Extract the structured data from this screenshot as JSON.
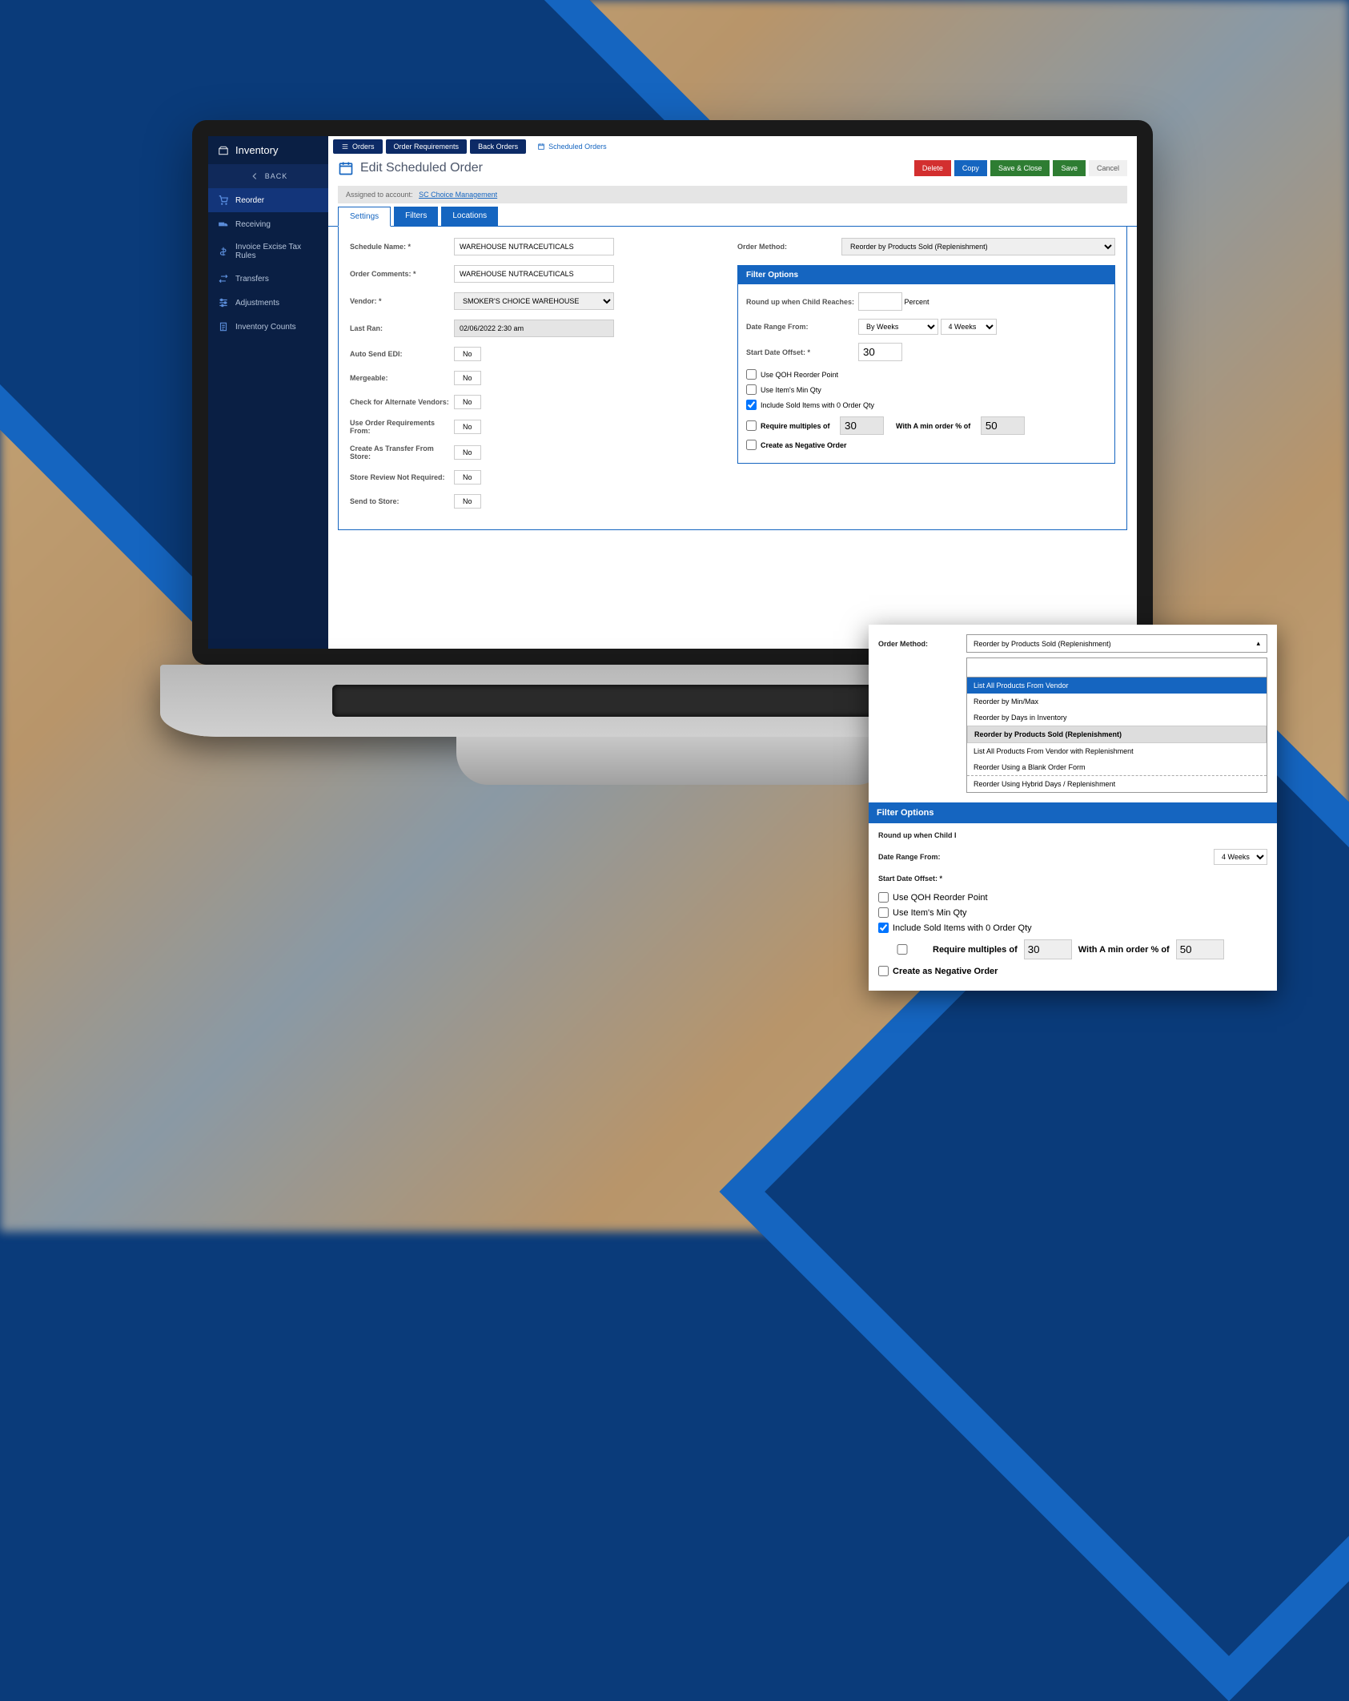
{
  "sidebar": {
    "title": "Inventory",
    "back": "BACK",
    "items": [
      {
        "label": "Reorder"
      },
      {
        "label": "Receiving"
      },
      {
        "label": "Invoice Excise Tax Rules"
      },
      {
        "label": "Transfers"
      },
      {
        "label": "Adjustments"
      },
      {
        "label": "Inventory Counts"
      }
    ]
  },
  "topTabs": [
    {
      "label": "Orders"
    },
    {
      "label": "Order Requirements"
    },
    {
      "label": "Back Orders"
    },
    {
      "label": "Scheduled Orders"
    }
  ],
  "page": {
    "title": "Edit Scheduled Order",
    "buttons": {
      "delete": "Delete",
      "copy": "Copy",
      "saveClose": "Save & Close",
      "save": "Save",
      "cancel": "Cancel"
    }
  },
  "assigned": {
    "label": "Assigned to account:",
    "link": "SC Choice Management"
  },
  "subTabs": {
    "settings": "Settings",
    "filters": "Filters",
    "locations": "Locations"
  },
  "left": {
    "scheduleName": {
      "label": "Schedule Name: *",
      "value": "WAREHOUSE NUTRACEUTICALS"
    },
    "orderComments": {
      "label": "Order Comments: *",
      "value": "WAREHOUSE NUTRACEUTICALS"
    },
    "vendor": {
      "label": "Vendor: *",
      "value": "SMOKER'S CHOICE WAREHOUSE"
    },
    "lastRan": {
      "label": "Last Ran:",
      "value": "02/06/2022 2:30 am"
    },
    "autoSend": {
      "label": "Auto Send EDI:",
      "btn": "No"
    },
    "mergeable": {
      "label": "Mergeable:",
      "btn": "No"
    },
    "checkAlt": {
      "label": "Check for Alternate Vendors:",
      "btn": "No"
    },
    "useReq": {
      "label": "Use Order Requirements From:",
      "btn": "No"
    },
    "createTransfer": {
      "label": "Create As Transfer From Store:",
      "btn": "No"
    },
    "storeReview": {
      "label": "Store Review Not Required:",
      "btn": "No"
    },
    "sendStore": {
      "label": "Send to Store:",
      "btn": "No"
    }
  },
  "right": {
    "orderMethodLabel": "Order Method:",
    "orderMethodValue": "Reorder by Products Sold (Replenishment)",
    "filterOptions": "Filter Options",
    "roundUp": "Round up when Child Reaches:",
    "percent": "Percent",
    "dateRange": "Date Range From:",
    "byWeeks": "By Weeks",
    "fourWeeks": "4 Weeks",
    "startOffset": "Start Date Offset: *",
    "startOffsetVal": "30",
    "useQOH": "Use QOH Reorder Point",
    "useMin": "Use Item's Min Qty",
    "includeSold": "Include Sold Items with 0 Order Qty",
    "requireMult": "Require multiples of",
    "reqVal": "30",
    "withMin": "With A min order % of",
    "minVal": "50",
    "negOrder": "Create as Negative Order"
  },
  "zoom": {
    "orderMethodLabel": "Order Method:",
    "orderMethodValue": "Reorder by Products Sold (Replenishment)",
    "options": [
      "List All Products From Vendor",
      "Reorder by Min/Max",
      "Reorder by Days in Inventory",
      "Reorder by Products Sold (Replenishment)",
      "List All Products From Vendor with Replenishment",
      "Reorder Using a Blank Order Form",
      "Reorder Using Hybrid Days / Replenishment"
    ],
    "filterOptions": "Filter Options",
    "roundUp": "Round up when Child I",
    "dateRange": "Date Range From:",
    "fourWeeks": "4 Weeks",
    "startOffset": "Start Date Offset: *",
    "useQOH": "Use QOH Reorder Point",
    "useMin": "Use Item's Min Qty",
    "includeSold": "Include Sold Items with 0 Order Qty",
    "requireMult": "Require multiples of",
    "reqVal": "30",
    "withMin": "With A min order % of",
    "minVal": "50",
    "negOrder": "Create as Negative Order"
  }
}
